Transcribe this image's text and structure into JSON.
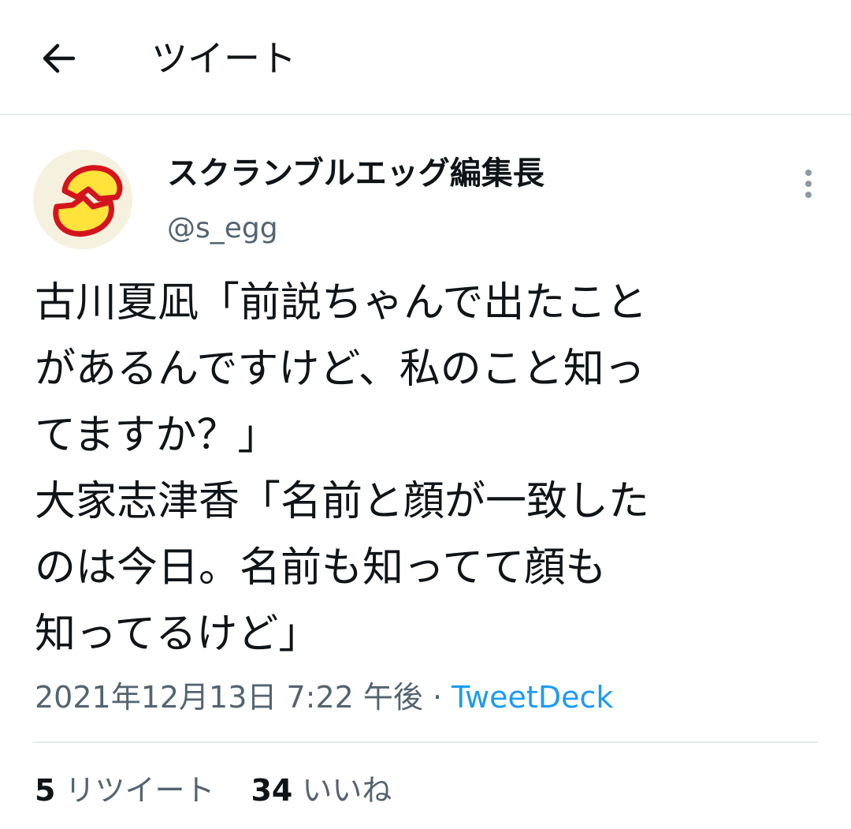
{
  "header": {
    "title": "ツイート",
    "back_icon": "arrow-left-icon"
  },
  "author": {
    "name": "スクランブルエッグ編集長",
    "handle": "@s_egg",
    "avatar_icon": "broken-egg-icon"
  },
  "more_icon": "vertical-ellipsis-icon",
  "tweet": {
    "lines": [
      "古川夏凪「前説ちゃんで出たこと",
      "があるんですけど、私のこと知っ",
      "てますか？」",
      "大家志津香「名前と顔が一致した",
      "のは今日。名前も知ってて顔も",
      "知ってるけど」"
    ],
    "timestamp": "2021年12月13日 7:22 午後",
    "separator": "·",
    "source": "TweetDeck"
  },
  "stats": {
    "retweets_count": "5",
    "retweets_label": "リツイート",
    "likes_count": "34",
    "likes_label": "いいね"
  },
  "colors": {
    "text": "#0f1419",
    "secondary": "#536471",
    "link": "#1d9bf0",
    "divider": "#e6ecf0"
  }
}
